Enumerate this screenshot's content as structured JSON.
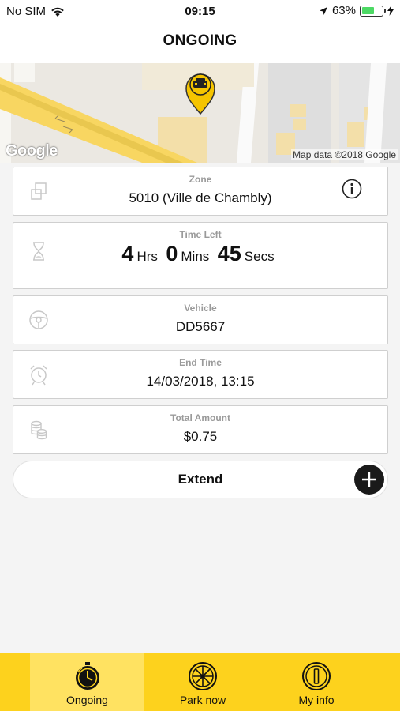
{
  "status_bar": {
    "carrier": "No SIM",
    "time": "09:15",
    "battery_percent": "63%",
    "battery_level": 0.63,
    "icons": [
      "wifi-icon",
      "location-arrow-icon",
      "battery-icon",
      "charging-icon"
    ]
  },
  "nav": {
    "title": "ONGOING"
  },
  "map": {
    "logo_text": "Google",
    "attribution": "Map data ©2018 Google",
    "marker_icon": "car-pin-icon"
  },
  "zone": {
    "label": "Zone",
    "value": "5010 (Ville de Chambly)",
    "icon": "zone-squares-icon",
    "info_icon": "info-icon"
  },
  "time_left": {
    "label": "Time Left",
    "hours": "4",
    "hours_unit": "Hrs",
    "minutes": "0",
    "minutes_unit": "Mins",
    "seconds": "45",
    "seconds_unit": "Secs",
    "icon": "hourglass-icon"
  },
  "vehicle": {
    "label": "Vehicle",
    "value": "DD5667",
    "icon": "steering-wheel-icon"
  },
  "end_time": {
    "label": "End Time",
    "value": "14/03/2018, 13:15",
    "icon": "alarm-clock-icon"
  },
  "total_amount": {
    "label": "Total Amount",
    "value": "$0.75",
    "icon": "coins-icon"
  },
  "extend": {
    "label": "Extend",
    "icon": "plus-icon"
  },
  "tabs": [
    {
      "label": "Ongoing",
      "icon": "stopwatch-icon",
      "active": true
    },
    {
      "label": "Park now",
      "icon": "wheel-icon",
      "active": false
    },
    {
      "label": "My info",
      "icon": "info-icon",
      "active": false
    }
  ],
  "colors": {
    "accent": "#fdd21d",
    "accent_active": "#ffe261",
    "plus_button": "#1a1a1a"
  }
}
